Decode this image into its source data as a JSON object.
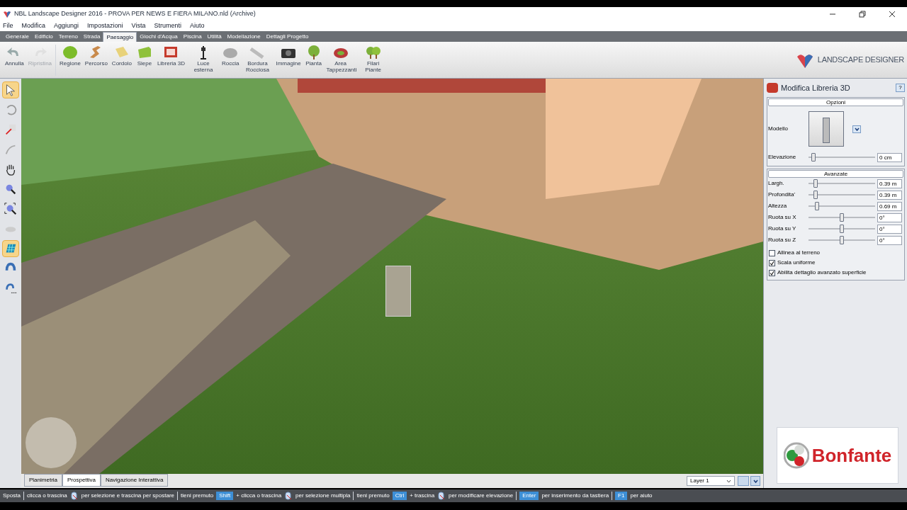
{
  "window": {
    "title": "NBL Landscape Designer 2016 - PROVA PER NEWS E FIERA MILANO.nld (Archive)"
  },
  "menu": [
    "File",
    "Modifica",
    "Aggiungi",
    "Impostazioni",
    "Vista",
    "Strumenti",
    "Aiuto"
  ],
  "ribbon_tabs": [
    {
      "label": "Generale",
      "selected": false
    },
    {
      "label": "Edificio",
      "selected": false
    },
    {
      "label": "Terreno",
      "selected": false
    },
    {
      "label": "Strada",
      "selected": false
    },
    {
      "label": "Paesaggio",
      "selected": true
    },
    {
      "label": "Giochi d'Acqua",
      "selected": false
    },
    {
      "label": "Piscina",
      "selected": false
    },
    {
      "label": "Utilità",
      "selected": false
    },
    {
      "label": "Modellazione",
      "selected": false
    },
    {
      "label": "Dettagli Progetto",
      "selected": false
    }
  ],
  "toolbar": [
    {
      "label": "Annulla",
      "disabled": false
    },
    {
      "label": "Ripristina",
      "disabled": true
    },
    {
      "label": "Regione",
      "disabled": false
    },
    {
      "label": "Percorso",
      "disabled": false
    },
    {
      "label": "Cordolo",
      "disabled": false
    },
    {
      "label": "Siepe",
      "disabled": false
    },
    {
      "label": "Libreria 3D",
      "disabled": false
    },
    {
      "label": "Luce esterna",
      "disabled": false
    },
    {
      "label": "Roccia",
      "disabled": false
    },
    {
      "label": "Bordura Rocciosa",
      "disabled": false
    },
    {
      "label": "Immagine",
      "disabled": false
    },
    {
      "label": "Pianta",
      "disabled": false
    },
    {
      "label": "Area Tappezzanti",
      "disabled": false
    },
    {
      "label": "Filari Piante",
      "disabled": false
    }
  ],
  "brand": {
    "name": "LANDSCAPE DESIGNER"
  },
  "left_tools": [
    {
      "selected": true
    },
    {
      "selected": false
    },
    {
      "selected": false
    },
    {
      "selected": false
    },
    {
      "selected": false
    },
    {
      "selected": false
    },
    {
      "selected": false
    },
    {
      "selected": false
    },
    {
      "selected": true
    },
    {
      "selected": false
    },
    {
      "selected": false
    }
  ],
  "view_tabs": [
    {
      "label": "Planimetria",
      "selected": false
    },
    {
      "label": "Prospettiva",
      "selected": true
    },
    {
      "label": "Navigazione Interattiva",
      "selected": false
    }
  ],
  "layer_select": {
    "value": "Layer 1"
  },
  "panel": {
    "title": "Modifica Libreria 3D",
    "help": "?",
    "options_header": "Opzioni",
    "model_label": "Modello",
    "elevation": {
      "label": "Elevazione",
      "level": 0.05,
      "value": "0 cm"
    },
    "advanced_header": "Avanzate",
    "sliders": [
      {
        "label": "Largh.",
        "level": 0.08,
        "value": "0.39 m"
      },
      {
        "label": "Profondita'",
        "level": 0.08,
        "value": "0.39 m"
      },
      {
        "label": "Altezza",
        "level": 0.1,
        "value": "0.69 m"
      },
      {
        "label": "Ruota su X",
        "level": 0.5,
        "value": "0°"
      },
      {
        "label": "Ruota su Y",
        "level": 0.5,
        "value": "0°"
      },
      {
        "label": "Ruota su Z",
        "level": 0.5,
        "value": "0°"
      }
    ],
    "checkboxes": [
      {
        "label": "Allinea al terreno",
        "checked": false
      },
      {
        "label": "Scala uniforme",
        "checked": true
      },
      {
        "label": "Abilita dettaglio avanzato superficie",
        "checked": true
      }
    ]
  },
  "sponsor": {
    "name": "Bonfante"
  },
  "status_bar": [
    {
      "kind": "text",
      "text": "Sposta"
    },
    {
      "kind": "sep"
    },
    {
      "kind": "text",
      "text": "clicca o trascina"
    },
    {
      "kind": "mouse"
    },
    {
      "kind": "text",
      "text": "per selezione e trascina per spostare"
    },
    {
      "kind": "sep"
    },
    {
      "kind": "text",
      "text": "tieni premuto"
    },
    {
      "kind": "key",
      "text": "Shift"
    },
    {
      "kind": "text",
      "text": "+ clicca o trascina"
    },
    {
      "kind": "mouse"
    },
    {
      "kind": "text",
      "text": "per selezione multipla"
    },
    {
      "kind": "sep"
    },
    {
      "kind": "text",
      "text": "tieni premuto"
    },
    {
      "kind": "key",
      "text": "Ctrl"
    },
    {
      "kind": "text",
      "text": "+ trascina"
    },
    {
      "kind": "mouse"
    },
    {
      "kind": "text",
      "text": "per modificare elevazione"
    },
    {
      "kind": "sep"
    },
    {
      "kind": "key",
      "text": "Enter"
    },
    {
      "kind": "text",
      "text": "per inserimento da tastiera"
    },
    {
      "kind": "sep"
    },
    {
      "kind": "key",
      "text": "F1"
    },
    {
      "kind": "text",
      "text": "per aiuto"
    }
  ]
}
